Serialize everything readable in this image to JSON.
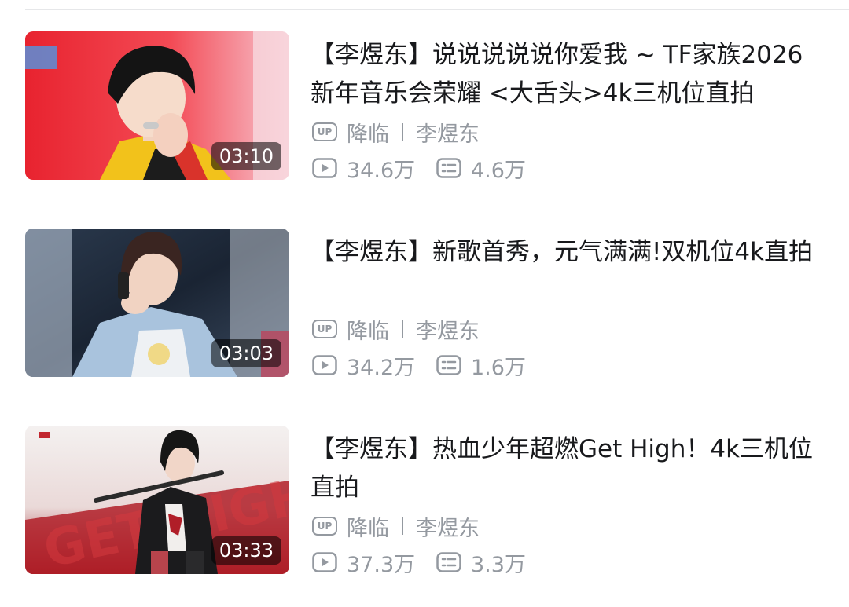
{
  "videos": [
    {
      "title": "【李煜东】说说说说说你爱我 ~ TF家族2026新年音乐会荣耀 <大舌头>4k三机位直拍",
      "duration": "03:10",
      "uploader_label": "降临",
      "uploader_name": "李煜东",
      "plays": "34.6万",
      "comments": "4.6万"
    },
    {
      "title": "【李煜东】新歌首秀，元气满满!双机位4k直拍",
      "duration": "03:03",
      "uploader_label": "降临",
      "uploader_name": "李煜东",
      "plays": "34.2万",
      "comments": "1.6万"
    },
    {
      "title": "【李煜东】热血少年超燃Get High！4k三机位直拍",
      "duration": "03:33",
      "uploader_label": "降临",
      "uploader_name": "李煜东",
      "plays": "37.3万",
      "comments": "3.3万"
    }
  ],
  "badge_text": "UP",
  "thumbnail_text": {
    "get_high": "GET HIGH"
  },
  "icons": {
    "up": "up-badge-icon",
    "play": "play-count-icon",
    "comment": "danmaku-count-icon"
  },
  "colors": {
    "text_primary": "#18191c",
    "text_secondary": "#9499a0",
    "duration_bg": "rgba(0,0,0,0.55)"
  }
}
